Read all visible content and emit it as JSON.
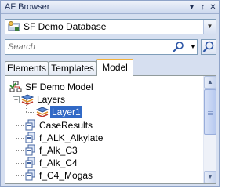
{
  "window": {
    "title": "AF Browser"
  },
  "database": {
    "name": "SF Demo Database"
  },
  "search": {
    "placeholder": "Search"
  },
  "tabs": [
    {
      "label": "Elements",
      "active": false
    },
    {
      "label": "Templates",
      "active": false
    },
    {
      "label": "Model",
      "active": true
    }
  ],
  "tree": {
    "root": "SF Demo Model",
    "layers": "Layers",
    "layer1": "Layer1",
    "items": [
      "CaseResults",
      "f_ALK_Alkylate",
      "f_Alk_C3",
      "f_Alk_C4",
      "f_C4_Mogas"
    ]
  },
  "colors": {
    "selection": "#3169c6",
    "active_tab_accent": "#f2b33d",
    "panel": "#d6dff0"
  }
}
